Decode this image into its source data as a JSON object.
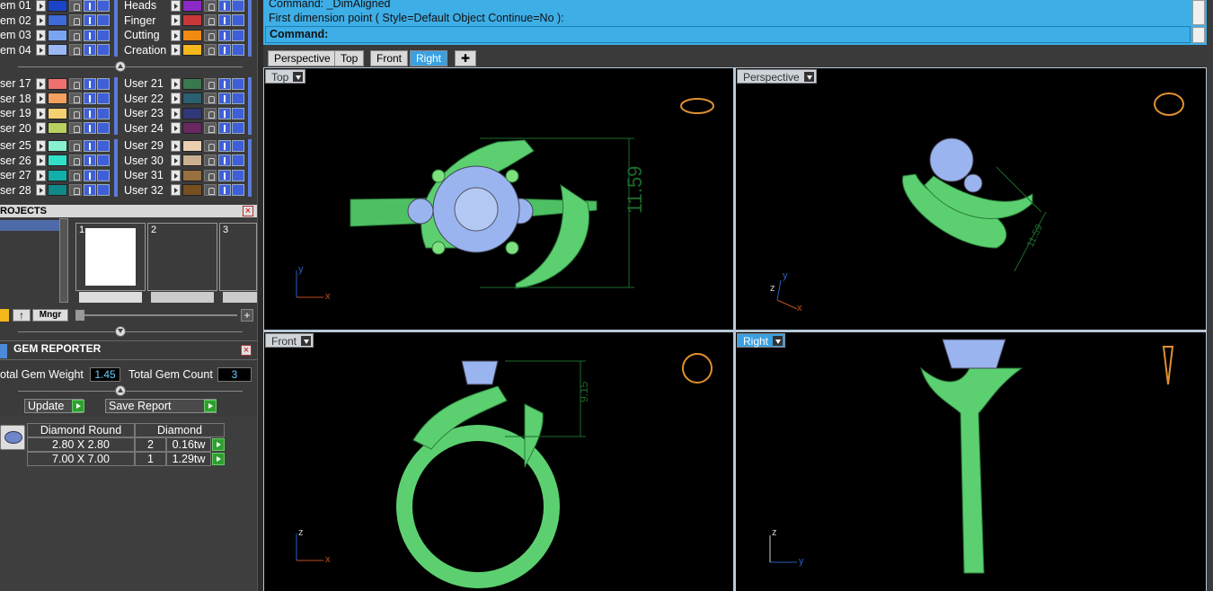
{
  "layers": {
    "group1": [
      {
        "label": "em 01",
        "color": "#1a44c8"
      },
      {
        "label": "em 02",
        "color": "#3e6ad8"
      },
      {
        "label": "em 03",
        "color": "#7aa4f0"
      },
      {
        "label": "em 04",
        "color": "#9bb8f4"
      }
    ],
    "group1b": [
      {
        "label": "Heads",
        "color": "#8c2ac8"
      },
      {
        "label": "Finger",
        "color": "#c83838"
      },
      {
        "label": "Cutting",
        "color": "#f08a10"
      },
      {
        "label": "Creation",
        "color": "#f4b81c"
      }
    ],
    "group2": [
      {
        "label": "ser 17",
        "color": "#f07070"
      },
      {
        "label": "ser 18",
        "color": "#f4a060"
      },
      {
        "label": "ser 19",
        "color": "#f4d070"
      },
      {
        "label": "ser 20",
        "color": "#b8d060"
      }
    ],
    "group2b": [
      {
        "label": "User 21",
        "color": "#3a7850"
      },
      {
        "label": "User 22",
        "color": "#2a6070"
      },
      {
        "label": "User 23",
        "color": "#303878"
      },
      {
        "label": "User 24",
        "color": "#682860"
      }
    ],
    "group3": [
      {
        "label": "ser 25",
        "color": "#88f0d0"
      },
      {
        "label": "ser 26",
        "color": "#30e0c8"
      },
      {
        "label": "ser 27",
        "color": "#10b0a8"
      },
      {
        "label": "ser 28",
        "color": "#108888"
      }
    ],
    "group3b": [
      {
        "label": "User 29",
        "color": "#e8d0b0"
      },
      {
        "label": "User 30",
        "color": "#c8b090"
      },
      {
        "label": "User 31",
        "color": "#987040"
      },
      {
        "label": "User 32",
        "color": "#785020"
      }
    ]
  },
  "projects": {
    "title": "ROJECTS",
    "slots": [
      "1",
      "2",
      "3"
    ],
    "manager_label": "Mngr"
  },
  "gem_reporter": {
    "title": "GEM REPORTER",
    "total_weight_label": "otal Gem Weight",
    "total_weight_value": "1.45",
    "total_count_label": "Total Gem Count",
    "total_count_value": "3",
    "update_label": "Update",
    "save_label": "Save Report",
    "table_headers": [
      "Diamond Round",
      "Diamond"
    ],
    "rows": [
      {
        "size": "2.80 X 2.80",
        "count": "2",
        "weight": "0.16tw"
      },
      {
        "size": "7.00 X 7.00",
        "count": "1",
        "weight": "1.29tw"
      }
    ]
  },
  "command": {
    "line1": "Command: _DimAligned",
    "line2": "First dimension point ( Style=Default  Object  Continue=No ):",
    "prompt": "Command:"
  },
  "tabs": [
    "Perspective",
    "Top",
    "Front",
    "Right",
    "✚"
  ],
  "viewports": {
    "top": {
      "label": "Top",
      "dimension": "11.59"
    },
    "perspective": {
      "label": "Perspective",
      "dimension": "11.59"
    },
    "front": {
      "label": "Front",
      "dimension": "9.15"
    },
    "right": {
      "label": "Right"
    }
  },
  "axes": {
    "x": "x",
    "y": "y",
    "z": "z"
  }
}
